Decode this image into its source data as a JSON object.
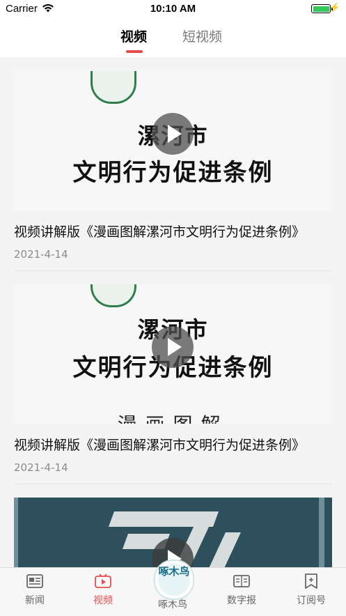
{
  "status_bar": {
    "carrier": "Carrier",
    "time": "10:10 AM"
  },
  "tabs": [
    {
      "label": "视频",
      "active": true
    },
    {
      "label": "短视频",
      "active": false
    }
  ],
  "accent_color": "#e74c4c",
  "feed": [
    {
      "thumb_line1": "漯河市",
      "thumb_line2": "文明行为促进条例",
      "title": "视频讲解版《漫画图解漯河市文明行为促进条例》",
      "date": "2021-4-14"
    },
    {
      "thumb_line1": "漯河市",
      "thumb_line2": "文明行为促进条例",
      "thumb_line3": "漫画图解",
      "title": "视频讲解版《漫画图解漯河市文明行为促进条例》",
      "date": "2021-4-14"
    }
  ],
  "tabbar": {
    "items": [
      {
        "label": "新闻",
        "icon": "news-icon"
      },
      {
        "label": "视频",
        "icon": "video-icon",
        "active": true
      },
      {
        "label": "啄木鸟",
        "icon": "woodpecker-logo"
      },
      {
        "label": "数字报",
        "icon": "newspaper-icon"
      },
      {
        "label": "订阅号",
        "icon": "subscribe-icon"
      }
    ],
    "center_logo_text": "啄木鸟"
  }
}
